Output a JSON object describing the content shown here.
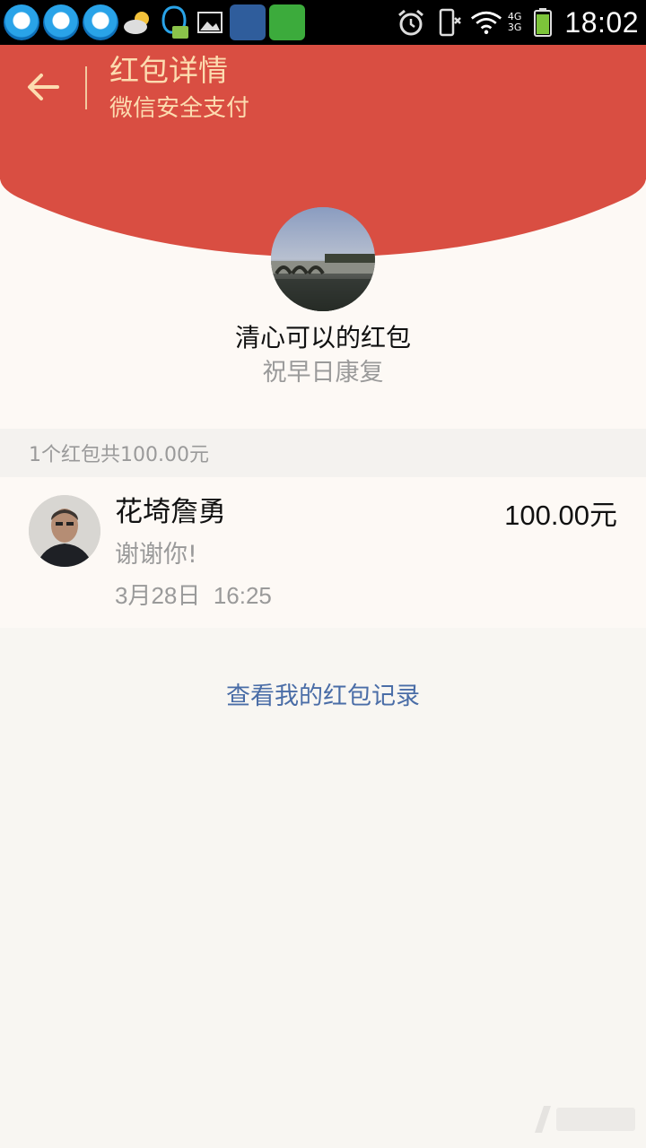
{
  "status_bar": {
    "time": "18:02",
    "network_top": "4G",
    "network_bottom": "3G",
    "icons": [
      "qq-icon",
      "qq-icon",
      "qq-icon",
      "weather-icon",
      "qq-message-icon",
      "gallery-icon",
      "news-app-icon",
      "chat-app-icon",
      "alarm-icon",
      "silent-icon",
      "wifi-icon",
      "signal-icon",
      "battery-icon"
    ]
  },
  "header": {
    "title": "红包详情",
    "subtitle": "微信安全支付",
    "back_icon": "arrow-left-icon"
  },
  "sender": {
    "name": "清心可以的红包",
    "wish": "祝早日康复"
  },
  "summary": {
    "text": "1个红包共100.00元"
  },
  "receivers": [
    {
      "name": "花埼詹勇",
      "amount": "100.00元",
      "message": "谢谢你!",
      "time": "3月28日  16:25"
    }
  ],
  "link": {
    "label": "查看我的红包记录"
  },
  "colors": {
    "header_red": "#d94e42",
    "header_text": "#fcdcb0",
    "link_blue": "#4a6da7",
    "page_bg": "#f8f6f2"
  }
}
